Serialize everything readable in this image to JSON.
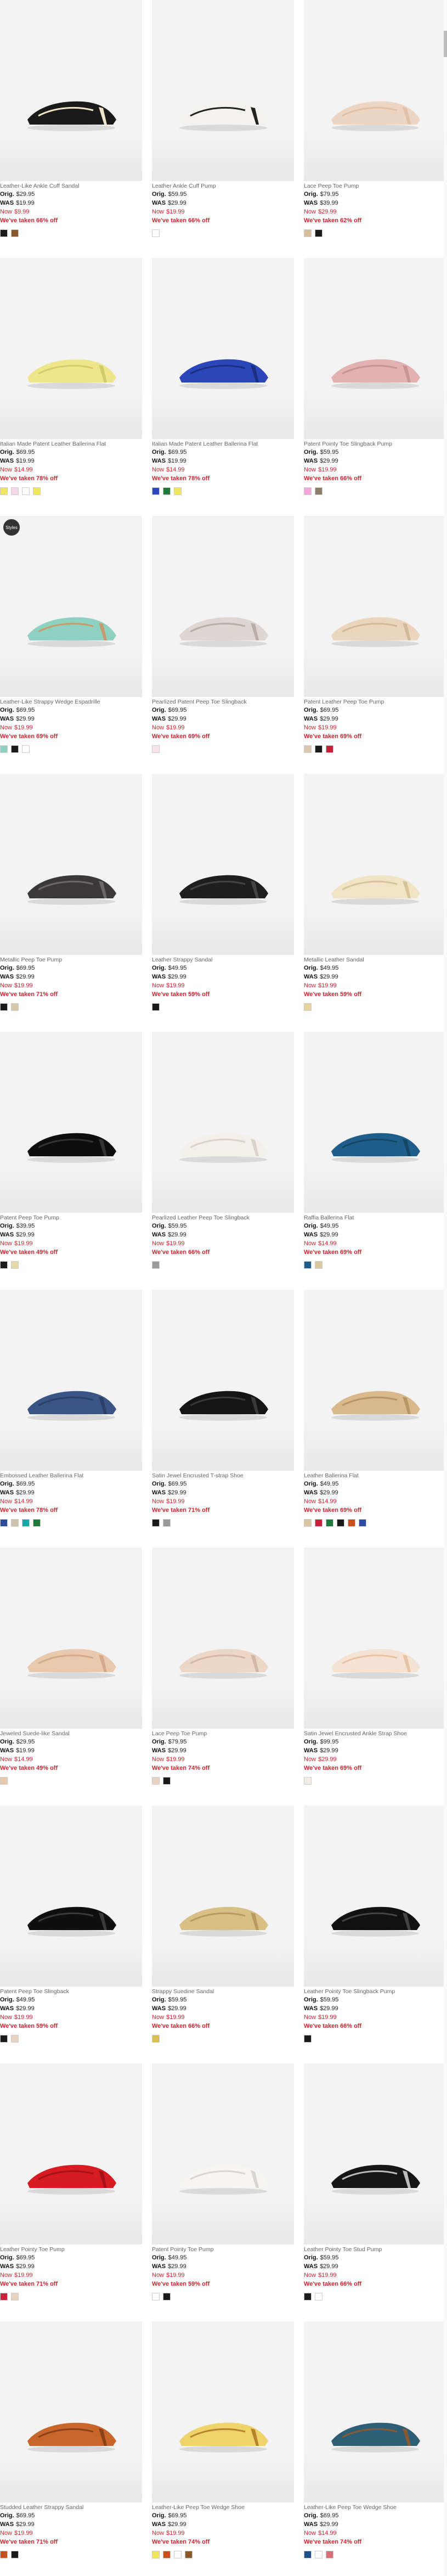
{
  "products": [
    {
      "name": "Leather-Like Ankle Cuff Sandal",
      "orig": "$29.95",
      "was": "$19.99",
      "now": "$9.99",
      "taken": "We've taken 66% off",
      "color": "#1a1a1a",
      "accent": "#efe6c9",
      "swatches": [
        "#1a1a1a",
        "#8b5a2b"
      ],
      "badge": false
    },
    {
      "name": "Leather Ankle Cuff Pump",
      "orig": "$59.95",
      "was": "$29.99",
      "now": "$19.99",
      "taken": "We've taken 66% off",
      "color": "#f4f2ee",
      "accent": "#222",
      "swatches": [
        "#ffffff"
      ],
      "badge": false
    },
    {
      "name": "Lace Peep Toe Pump",
      "orig": "$79.95",
      "was": "$39.99",
      "now": "$29.99",
      "taken": "We've taken 62% off",
      "color": "#ecd5c2",
      "accent": "#e2c0a8",
      "swatches": [
        "#d9bd9d",
        "#1a1a1a"
      ],
      "badge": false
    },
    {
      "name": "Italian Made Patent Leather Ballerina Flat",
      "orig": "$69.95",
      "was": "$19.99",
      "now": "$14.99",
      "taken": "We've taken 78% off",
      "color": "#efe58a",
      "accent": "#d6cb6b",
      "swatches": [
        "#f2e562",
        "#f7d7ea",
        "#ffffff",
        "#f2e562"
      ],
      "badge": false
    },
    {
      "name": "Italian Made Patent Leather Ballerina Flat",
      "orig": "$69.95",
      "was": "$19.99",
      "now": "$14.99",
      "taken": "We've taken 78% off",
      "color": "#2a46b8",
      "accent": "#1c2f82",
      "swatches": [
        "#2a46b8",
        "#1e7a3a",
        "#f2e562"
      ],
      "badge": false
    },
    {
      "name": "Patent Pointy Toe Slingback Pump",
      "orig": "$59.95",
      "was": "$29.99",
      "now": "$19.99",
      "taken": "We've taken 66% off",
      "color": "#e2b1b2",
      "accent": "#c89495",
      "swatches": [
        "#f2a7d8",
        "#8b7d6b"
      ],
      "badge": false
    },
    {
      "name": "Leather-Like Strappy Wedge Espadrille",
      "orig": "$69.95",
      "was": "$29.99",
      "now": "$19.99",
      "taken": "We've taken 69% off",
      "color": "#8fd1c0",
      "accent": "#c79b6b",
      "swatches": [
        "#8fd1c0",
        "#1a1a1a",
        "#ffffff"
      ],
      "badge": true
    },
    {
      "name": "Pearlized Patent Peep Toe Slingback",
      "orig": "$69.95",
      "was": "$29.99",
      "now": "$19.99",
      "taken": "We've taken 69% off",
      "color": "#ded6d0",
      "accent": "#b9aea7",
      "swatches": [
        "#f7e4ea"
      ],
      "badge": false
    },
    {
      "name": "Patent Leather Peep Toe Pump",
      "orig": "$69.95",
      "was": "$29.99",
      "now": "$19.99",
      "taken": "We've taken 69% off",
      "color": "#ebd5bd",
      "accent": "#d1b898",
      "swatches": [
        "#d9c7b0",
        "#1a1a1a",
        "#c8203a"
      ],
      "badge": false
    },
    {
      "name": "Metallic Peep Toe Pump",
      "orig": "$69.95",
      "was": "$29.99",
      "now": "$19.99",
      "taken": "We've taken 71% off",
      "color": "#3a3838",
      "accent": "#6a6868",
      "swatches": [
        "#1a1a1a",
        "#d8c6a8"
      ],
      "badge": false
    },
    {
      "name": "Leather Strappy Sandal",
      "orig": "$49.95",
      "was": "$29.99",
      "now": "$19.99",
      "taken": "We've taken 59% off",
      "color": "#1e1e1e",
      "accent": "#444",
      "swatches": [
        "#1a1a1a"
      ],
      "badge": false
    },
    {
      "name": "Metallic Leather Sandal",
      "orig": "$49.95",
      "was": "$29.99",
      "now": "$19.99",
      "taken": "We've taken 59% off",
      "color": "#f0e4c4",
      "accent": "#d6c49b",
      "swatches": [
        "#e6d49a"
      ],
      "badge": false
    },
    {
      "name": "Patent Peep Toe Pump",
      "orig": "$39.95",
      "was": "$29.99",
      "now": "$19.99",
      "taken": "We've taken 49% off",
      "color": "#0e0e0e",
      "accent": "#333",
      "swatches": [
        "#1a1a1a",
        "#e9d9a6"
      ],
      "badge": false
    },
    {
      "name": "Pearlized Leather Peep Toe Slingback",
      "orig": "$59.95",
      "was": "$29.99",
      "now": "$19.99",
      "taken": "We've taken 66% off",
      "color": "#f3efe9",
      "accent": "#d8d2c8",
      "swatches": [
        "#9a9a9a"
      ],
      "badge": false
    },
    {
      "name": "Raffia Ballerina Flat",
      "orig": "$49.95",
      "was": "$29.99",
      "now": "$14.99",
      "taken": "We've taken 69% off",
      "color": "#1f5e8a",
      "accent": "#154765",
      "swatches": [
        "#1f5e8a",
        "#d9c7a0"
      ],
      "badge": false
    },
    {
      "name": "Embossed Leather Ballerina Flat",
      "orig": "$69.95",
      "was": "$29.99",
      "now": "$14.99",
      "taken": "We've taken 78% off",
      "color": "#3b5486",
      "accent": "#2b3f67",
      "swatches": [
        "#2e4a9a",
        "#cfc3ad",
        "#1aa6a6",
        "#1e7a3a"
      ],
      "badge": false
    },
    {
      "name": "Satin Jewel Encrusted T-strap Shoe",
      "orig": "$69.95",
      "was": "$29.99",
      "now": "$19.99",
      "taken": "We've taken 71% off",
      "color": "#141414",
      "accent": "#3a3a3a",
      "swatches": [
        "#1a1a1a",
        "#9a9a9a"
      ],
      "badge": false
    },
    {
      "name": "Leather Ballerina Flat",
      "orig": "$49.95",
      "was": "$29.99",
      "now": "$14.99",
      "taken": "We've taken 69% off",
      "color": "#d9b98b",
      "accent": "#b99465",
      "swatches": [
        "#d9c7a0",
        "#c8203a",
        "#1e7a3a",
        "#1a1a1a",
        "#c84f1e",
        "#2e4a9a"
      ],
      "badge": false
    },
    {
      "name": "Jeweled Suede-like Sandal",
      "orig": "$29.95",
      "was": "$19.99",
      "now": "$14.99",
      "taken": "We've taken 49% off",
      "color": "#e8c9ad",
      "accent": "#d3aa8a",
      "swatches": [
        "#e8c9ad"
      ],
      "badge": false
    },
    {
      "name": "Lace Peep Toe Pump",
      "orig": "$79.95",
      "was": "$29.99",
      "now": "$19.99",
      "taken": "We've taken 74% off",
      "color": "#ecd6c6",
      "accent": "#d2b7a4",
      "swatches": [
        "#e8d4c0",
        "#1a1a1a"
      ],
      "badge": false
    },
    {
      "name": "Satin Jewel Encrusted Ankle Strap Shoe",
      "orig": "$99.95",
      "was": "$29.99",
      "now": "$29.99",
      "taken": "We've taken 69% off",
      "color": "#f4e2d2",
      "accent": "#e8c2a4",
      "swatches": [
        "#f2ece4"
      ],
      "badge": false
    },
    {
      "name": "Patent Peep Toe Slingback",
      "orig": "$49.95",
      "was": "$29.99",
      "now": "$19.99",
      "taken": "We've taken 59% off",
      "color": "#0f0f0f",
      "accent": "#3a3a3a",
      "swatches": [
        "#1a1a1a",
        "#e8d4c0"
      ],
      "badge": false
    },
    {
      "name": "Strappy Suedine Sandal",
      "orig": "$59.95",
      "was": "$29.99",
      "now": "$19.99",
      "taken": "We've taken 66% off",
      "color": "#d8bf86",
      "accent": "#b89a5e",
      "swatches": [
        "#d8bf50"
      ],
      "badge": false
    },
    {
      "name": "Leather Pointy Toe Slingback Pump",
      "orig": "$59.95",
      "was": "$29.99",
      "now": "$19.99",
      "taken": "We've taken 66% off",
      "color": "#111",
      "accent": "#444",
      "swatches": [
        "#1a1a1a"
      ],
      "badge": false
    },
    {
      "name": "Leather Pointy Toe Pump",
      "orig": "$69.95",
      "was": "$29.99",
      "now": "$19.99",
      "taken": "We've taken 71% off",
      "color": "#d61c22",
      "accent": "#a31218",
      "swatches": [
        "#c8203a",
        "#e8d4c0"
      ],
      "badge": false
    },
    {
      "name": "Patent Pointy Toe Pump",
      "orig": "$49.95",
      "was": "$29.99",
      "now": "$19.99",
      "taken": "We've taken 59% off",
      "color": "#f7f5f1",
      "accent": "#d9d5ce",
      "swatches": [
        "#ffffff",
        "#1a1a1a"
      ],
      "badge": false
    },
    {
      "name": "Leather Pointy Toe Stud Pump",
      "orig": "$59.95",
      "was": "$29.99",
      "now": "$19.99",
      "taken": "We've taken 66% off",
      "color": "#161616",
      "accent": "#bbb",
      "swatches": [
        "#1a1a1a",
        "#ffffff"
      ],
      "badge": false
    },
    {
      "name": "Studded Leather Strappy Sandal",
      "orig": "$69.95",
      "was": "$29.99",
      "now": "$19.99",
      "taken": "We've taken 71% off",
      "color": "#c8652b",
      "accent": "#8a4018",
      "swatches": [
        "#c84f1e",
        "#1a1a1a"
      ],
      "badge": false
    },
    {
      "name": "Leather-Like Peep Toe Wedge Shoe",
      "orig": "$69.95",
      "was": "$29.99",
      "now": "$19.99",
      "taken": "We've taken 74% off",
      "color": "#eed36a",
      "accent": "#b8832e",
      "swatches": [
        "#f2e562",
        "#c84f1e",
        "#ffffff",
        "#8b5a2b"
      ],
      "badge": false
    },
    {
      "name": "Leather-Like Peep Toe Wedge Shoe",
      "orig": "$69.95",
      "was": "$29.99",
      "now": "$14.99",
      "taken": "We've taken 74% off",
      "color": "#2d5e75",
      "accent": "#8a5a2e",
      "swatches": [
        "#1f4f8a",
        "#ffffff",
        "#d8707a"
      ],
      "badge": false
    }
  ],
  "labels": {
    "orig": "Orig.",
    "was": "WAS",
    "now": "Now"
  },
  "badge_text": "Styles"
}
